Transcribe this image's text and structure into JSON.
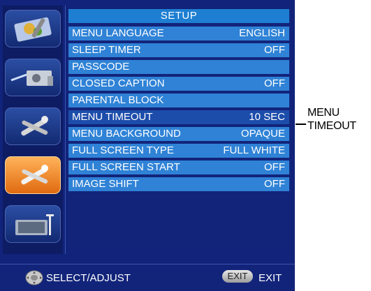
{
  "menu": {
    "title": "SETUP",
    "items": [
      {
        "label": "MENU LANGUAGE",
        "value": "ENGLISH"
      },
      {
        "label": "SLEEP TIMER",
        "value": "OFF"
      },
      {
        "label": "PASSCODE",
        "value": ""
      },
      {
        "label": "CLOSED CAPTION",
        "value": "OFF"
      },
      {
        "label": "PARENTAL BLOCK",
        "value": ""
      },
      {
        "label": "MENU TIMEOUT",
        "value": "10 SEC"
      },
      {
        "label": "MENU BACKGROUND",
        "value": "OPAQUE"
      },
      {
        "label": "FULL SCREEN TYPE",
        "value": "FULL WHITE"
      },
      {
        "label": "FULL SCREEN START",
        "value": "OFF"
      },
      {
        "label": "IMAGE SHIFT",
        "value": "OFF"
      }
    ],
    "selected_index": 5
  },
  "sidebar": {
    "icons": [
      "picture-adjust-icon",
      "projector-icon",
      "tools-icon",
      "setup-tools-icon",
      "display-monitor-icon"
    ],
    "active_index": 3
  },
  "footer": {
    "select_label": "SELECT/ADJUST",
    "exit_badge": "EXIT",
    "exit_label": "EXIT"
  },
  "callout": {
    "line1": "MENU",
    "line2": "TIMEOUT"
  },
  "colors": {
    "background": "#11237a",
    "row": "#2f82d6",
    "selected_row": "#1d4dab",
    "active_icon": "#f28a2a"
  }
}
